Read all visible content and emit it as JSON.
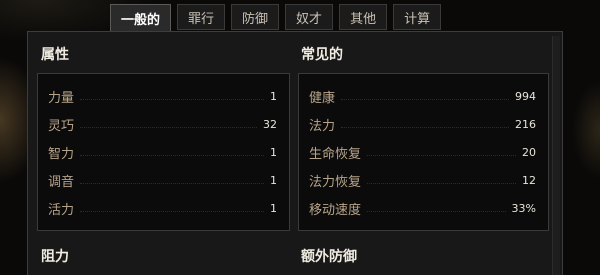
{
  "tabs": [
    {
      "label": "一般的",
      "active": true
    },
    {
      "label": "罪行",
      "active": false
    },
    {
      "label": "防御",
      "active": false
    },
    {
      "label": "奴才",
      "active": false
    },
    {
      "label": "其他",
      "active": false
    },
    {
      "label": "计算",
      "active": false
    }
  ],
  "sections": {
    "attributes": {
      "title": "属性",
      "rows": [
        {
          "label": "力量",
          "value": "1"
        },
        {
          "label": "灵巧",
          "value": "32"
        },
        {
          "label": "智力",
          "value": "1"
        },
        {
          "label": "调音",
          "value": "1"
        },
        {
          "label": "活力",
          "value": "1"
        }
      ]
    },
    "common": {
      "title": "常见的",
      "rows": [
        {
          "label": "健康",
          "value": "994"
        },
        {
          "label": "法力",
          "value": "216"
        },
        {
          "label": "生命恢复",
          "value": "20"
        },
        {
          "label": "法力恢复",
          "value": "12"
        },
        {
          "label": "移动速度",
          "value": "33%"
        }
      ]
    },
    "resistance": {
      "title": "阻力"
    },
    "extra_defense": {
      "title": "额外防御"
    }
  },
  "colors": {
    "label": "#b8a48a",
    "value": "#e9e4da",
    "title": "#f1ece2",
    "panel_bg": "#181818",
    "box_bg": "#0b0b0b"
  }
}
